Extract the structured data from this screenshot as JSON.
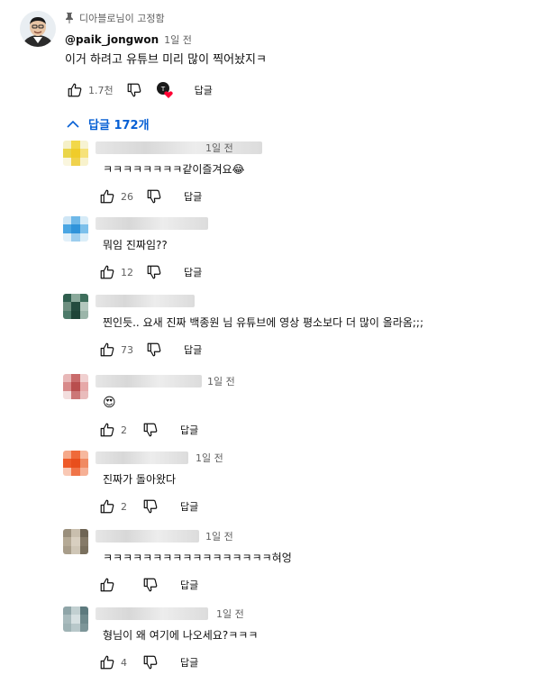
{
  "top_comment": {
    "pinned_text": "디아블로님이 고정함",
    "author": "@paik_jongwon",
    "time": "1일 전",
    "text": "이거 하려고 유튜브 미리 많이 찍어놨지ㅋ",
    "likes": "1.7천",
    "reply_label": "답글"
  },
  "replies_toggle": {
    "label": "답글 172개"
  },
  "replies": [
    {
      "time": "1일 전",
      "text": "ㅋㅋㅋㅋㅋㅋㅋㅋ같이즐겨요😂",
      "likes": "26",
      "reply_label": "답글",
      "avatar_colors": [
        "#f5f0c8",
        "#f2d84a",
        "#f7f3d2",
        "#ead54a",
        "#f0cc2a",
        "#f6e27a",
        "#faf6de",
        "#f0d24c",
        "#f8f2cc"
      ]
    },
    {
      "time": "",
      "text": "뭐임 진짜임??",
      "likes": "12",
      "reply_label": "답글",
      "avatar_colors": [
        "#cfe6f5",
        "#6fb8e8",
        "#d6ebf7",
        "#4aa6e3",
        "#2f93da",
        "#7cc0eb",
        "#e2f0f9",
        "#9ccdee",
        "#dbeef8"
      ]
    },
    {
      "time": "",
      "text": "찐인듯.. 요새 진짜 백종원 님 유튜브에 영상 평소보다 더 많이 올라옴;;;",
      "likes": "73",
      "reply_label": "답글",
      "avatar_colors": [
        "#2f5e4e",
        "#8aa99b",
        "#3e6e5c",
        "#6e8f80",
        "#244c3f",
        "#b3c7bd",
        "#4d7a69",
        "#1f4538",
        "#9bb5a9"
      ]
    },
    {
      "time": "1일 전",
      "text": "😍",
      "likes": "2",
      "reply_label": "답글",
      "avatar_colors": [
        "#e8b8b8",
        "#c96b6b",
        "#f0d0d0",
        "#d88a8a",
        "#b94e4e",
        "#e6a8a8",
        "#f3dede",
        "#cc7777",
        "#e9bcbc"
      ]
    },
    {
      "time": "1일 전",
      "text": "진짜가 돌아왔다",
      "likes": "2",
      "reply_label": "답글",
      "avatar_colors": [
        "#f5a98a",
        "#ef6a3a",
        "#f7b89e",
        "#ee5a28",
        "#e84e1c",
        "#f08a62",
        "#f9c8b4",
        "#f07448",
        "#f6b095"
      ]
    },
    {
      "time": "1일 전",
      "text": "ㅋㅋㅋㅋㅋㅋㅋㅋㅋㅋㅋㅋㅋㅋㅋㅋㅋ혀엉",
      "likes": "",
      "reply_label": "답글",
      "avatar_colors": [
        "#9a8f7c",
        "#c9bfae",
        "#6f6555",
        "#b5aa96",
        "#d8cfc0",
        "#857a68",
        "#a89d8a",
        "#cfc6b6",
        "#7a705e"
      ]
    },
    {
      "time": "1일 전",
      "text": "형님이 왜 여기에 나오세요?ㅋㅋㅋ",
      "likes": "4",
      "reply_label": "답글",
      "avatar_colors": [
        "#8fa5a8",
        "#c2d0d1",
        "#5d7a7e",
        "#a9bbbd",
        "#d6e0e1",
        "#6f8a8d",
        "#9fb3b5",
        "#b8c8ca",
        "#7c9598"
      ]
    }
  ],
  "icons": {
    "like": "thumb-up-icon",
    "dislike": "thumb-down-icon",
    "pin": "pin-icon",
    "chevron": "chevron-up-icon",
    "heart": "creator-heart-icon"
  },
  "colors": {
    "link_blue": "#065fd4",
    "heart_red": "#ff0033",
    "secondary_text": "#606060"
  }
}
